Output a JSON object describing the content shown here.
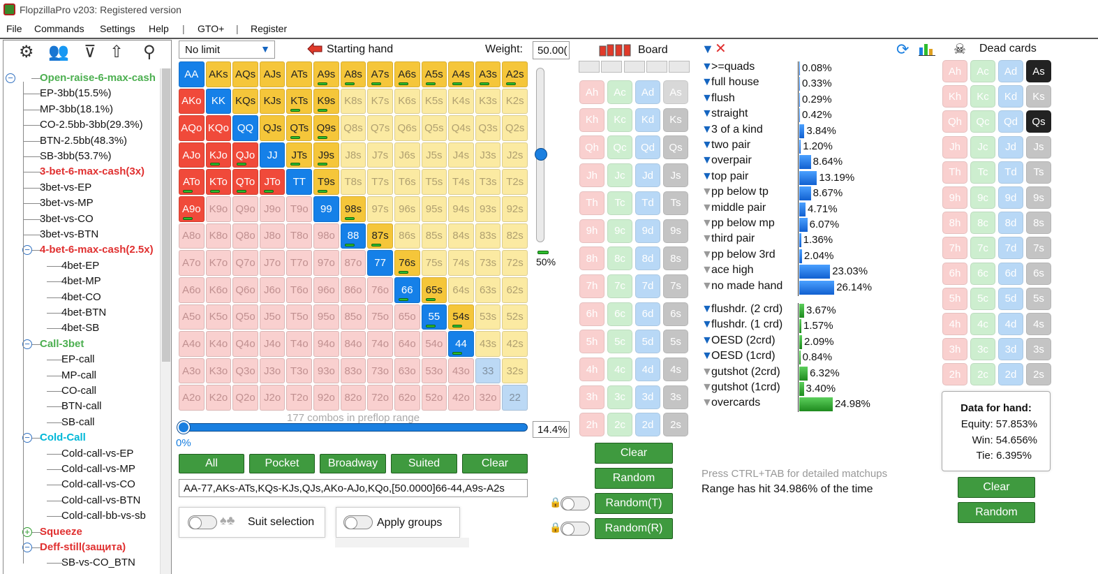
{
  "window": {
    "title": "FlopzillaPro v203: Registered version"
  },
  "menu": [
    "File",
    "Commands",
    "Settings",
    "Help",
    "|",
    "GTO+",
    "|",
    "Register"
  ],
  "tree": {
    "tool_icons": [
      "gear-icon",
      "users-icon",
      "filter-add-icon",
      "export-icon",
      "search-icon"
    ],
    "nodes": [
      {
        "label": "Open-raise-6-max-cash",
        "style": "green",
        "level": 0,
        "toggle": "−"
      },
      {
        "label": "EP-3bb(15.5%)",
        "style": "normal",
        "level": 1
      },
      {
        "label": "MP-3bb(18.1%)",
        "style": "normal",
        "level": 1
      },
      {
        "label": "CO-2.5bb-3bb(29.3%)",
        "style": "normal",
        "level": 1
      },
      {
        "label": "BTN-2.5bb(48.3%)",
        "style": "normal",
        "level": 1
      },
      {
        "label": "SB-3bb(53.7%)",
        "style": "normal",
        "level": 1
      },
      {
        "label": "3-bet-6-max-cash(3x)",
        "style": "red",
        "level": 1
      },
      {
        "label": "3bet-vs-EP",
        "style": "normal",
        "level": 1
      },
      {
        "label": "3bet-vs-MP",
        "style": "normal",
        "level": 1
      },
      {
        "label": "3bet-vs-CO",
        "style": "normal",
        "level": 1
      },
      {
        "label": "3bet-vs-BTN",
        "style": "normal",
        "level": 1
      },
      {
        "label": "4-bet-6-max-cash(2.5x)",
        "style": "red",
        "level": 1,
        "toggle": "−"
      },
      {
        "label": "4bet-EP",
        "style": "normal",
        "level": 2
      },
      {
        "label": "4bet-MP",
        "style": "normal",
        "level": 2
      },
      {
        "label": "4bet-CO",
        "style": "normal",
        "level": 2
      },
      {
        "label": "4bet-BTN",
        "style": "normal",
        "level": 2
      },
      {
        "label": "4bet-SB",
        "style": "normal",
        "level": 2
      },
      {
        "label": "Call-3bet",
        "style": "green",
        "level": 1,
        "toggle": "−"
      },
      {
        "label": "EP-call",
        "style": "normal",
        "level": 2
      },
      {
        "label": "MP-call",
        "style": "normal",
        "level": 2
      },
      {
        "label": "CO-call",
        "style": "normal",
        "level": 2
      },
      {
        "label": "BTN-call",
        "style": "normal",
        "level": 2
      },
      {
        "label": "SB-call",
        "style": "normal",
        "level": 2
      },
      {
        "label": "Cold-Call",
        "style": "cyan",
        "level": 1,
        "toggle": "−"
      },
      {
        "label": "Cold-call-vs-EP",
        "style": "normal",
        "level": 2
      },
      {
        "label": "Cold-call-vs-MP",
        "style": "normal",
        "level": 2
      },
      {
        "label": "Cold-call-vs-CO",
        "style": "normal",
        "level": 2
      },
      {
        "label": "Cold-call-vs-BTN",
        "style": "normal",
        "level": 2
      },
      {
        "label": "Cold-call-bb-vs-sb",
        "style": "normal",
        "level": 2
      },
      {
        "label": "Squeeze",
        "style": "red",
        "level": 1,
        "toggle": "+"
      },
      {
        "label": "Deff-still(защита)",
        "style": "red",
        "level": 1,
        "toggle": "−"
      },
      {
        "label": "SB-vs-CO_BTN",
        "style": "normal",
        "level": 2
      }
    ]
  },
  "range_panel": {
    "limit_select": "No limit",
    "starting_hand_label": "Starting hand",
    "weight_label": "Weight:",
    "weight_value": "50.00(",
    "vertical_slider_label": "50%",
    "combos_text": "177 combos in preflop range",
    "range_pct": "14.4%",
    "slider_min_label": "0%",
    "buttons": [
      "All",
      "Pocket",
      "Broadway",
      "Suited",
      "Clear"
    ],
    "range_text": "AA-77,AKs-ATs,KQs-KJs,QJs,AKo-AJo,KQo,[50.0000]66-44,A9s-A2s",
    "suit_selection_label": "Suit selection",
    "apply_groups_label": "Apply groups"
  },
  "hand_grid": {
    "ranks": [
      "A",
      "K",
      "Q",
      "J",
      "T",
      "9",
      "8",
      "7",
      "6",
      "5",
      "4",
      "3",
      "2"
    ],
    "cells": [
      [
        "AA:b",
        "AKs:y",
        "AQs:y",
        "AJs:y",
        "ATs:y",
        "A9s:yh",
        "A8s:yh",
        "A7s:yh",
        "A6s:yh",
        "A5s:yh",
        "A4s:yh",
        "A3s:yh",
        "A2s:yh"
      ],
      [
        "AKo:r",
        "KK:b",
        "KQs:y",
        "KJs:y",
        "KTs:yh",
        "K9s:yh",
        "K8s:l",
        "K7s:l",
        "K6s:l",
        "K5s:l",
        "K4s:l",
        "K3s:l",
        "K2s:l"
      ],
      [
        "AQo:r",
        "KQo:r",
        "QQ:b",
        "QJs:y",
        "QTs:yh",
        "Q9s:yh",
        "Q8s:l",
        "Q7s:l",
        "Q6s:l",
        "Q5s:l",
        "Q4s:l",
        "Q3s:l",
        "Q2s:l"
      ],
      [
        "AJo:r",
        "KJo:rh",
        "QJo:rh",
        "JJ:b",
        "JTs:yh",
        "J9s:yh",
        "J8s:l",
        "J7s:l",
        "J6s:l",
        "J5s:l",
        "J4s:l",
        "J3s:l",
        "J2s:l"
      ],
      [
        "ATo:rh",
        "KTo:rh",
        "QTo:rh",
        "JTo:rh",
        "TT:b",
        "T9s:yh",
        "T8s:l",
        "T7s:l",
        "T6s:l",
        "T5s:l",
        "T4s:l",
        "T3s:l",
        "T2s:l"
      ],
      [
        "A9o:rh",
        "K9o:p",
        "Q9o:p",
        "J9o:p",
        "T9o:p",
        "99:b",
        "98s:yh",
        "97s:l",
        "96s:l",
        "95s:l",
        "94s:l",
        "93s:l",
        "92s:l"
      ],
      [
        "A8o:p",
        "K8o:p",
        "Q8o:p",
        "J8o:p",
        "T8o:p",
        "98o:p",
        "88:bh",
        "87s:yh",
        "86s:l",
        "85s:l",
        "84s:l",
        "83s:l",
        "82s:l"
      ],
      [
        "A7o:p",
        "K7o:p",
        "Q7o:p",
        "J7o:p",
        "T7o:p",
        "97o:p",
        "87o:p",
        "77:b",
        "76s:yh",
        "75s:l",
        "74s:l",
        "73s:l",
        "72s:l"
      ],
      [
        "A6o:p",
        "K6o:p",
        "Q6o:p",
        "J6o:p",
        "T6o:p",
        "96o:p",
        "86o:p",
        "76o:p",
        "66:bh",
        "65s:yh",
        "64s:l",
        "63s:l",
        "62s:l"
      ],
      [
        "A5o:p",
        "K5o:p",
        "Q5o:p",
        "J5o:p",
        "T5o:p",
        "95o:p",
        "85o:p",
        "75o:p",
        "65o:p",
        "55:bh",
        "54s:yh",
        "53s:l",
        "52s:l"
      ],
      [
        "A4o:p",
        "K4o:p",
        "Q4o:p",
        "J4o:p",
        "T4o:p",
        "94o:p",
        "84o:p",
        "74o:p",
        "64o:p",
        "54o:p",
        "44:bh",
        "43s:l",
        "42s:l"
      ],
      [
        "A3o:p",
        "K3o:p",
        "Q3o:p",
        "J3o:p",
        "T3o:p",
        "93o:p",
        "83o:p",
        "73o:p",
        "63o:p",
        "53o:p",
        "43o:p",
        "33:c",
        "32s:l"
      ],
      [
        "A2o:p",
        "K2o:p",
        "Q2o:p",
        "J2o:p",
        "T2o:p",
        "92o:p",
        "82o:p",
        "72o:p",
        "62o:p",
        "52o:p",
        "42o:p",
        "32o:p",
        "22:c"
      ]
    ]
  },
  "board": {
    "label": "Board",
    "ranks": [
      "A",
      "K",
      "Q",
      "J",
      "T",
      "9",
      "8",
      "7",
      "6",
      "5",
      "4",
      "3",
      "2"
    ],
    "suits": [
      "h",
      "c",
      "d",
      "s"
    ],
    "buttons": [
      "Clear",
      "Random",
      "Random(T)",
      "Random(R)"
    ]
  },
  "stats": {
    "made_hands": [
      {
        "label": ">=quads",
        "value": "0.08%",
        "pct": 0.08,
        "filter": "blue"
      },
      {
        "label": "full house",
        "value": "0.33%",
        "pct": 0.33,
        "filter": "blue"
      },
      {
        "label": "flush",
        "value": "0.29%",
        "pct": 0.29,
        "filter": "blue"
      },
      {
        "label": "straight",
        "value": "0.42%",
        "pct": 0.42,
        "filter": "blue"
      },
      {
        "label": "3 of a kind",
        "value": "3.84%",
        "pct": 3.84,
        "filter": "blue"
      },
      {
        "label": "two pair",
        "value": "1.20%",
        "pct": 1.2,
        "filter": "blue"
      },
      {
        "label": "overpair",
        "value": "8.64%",
        "pct": 8.64,
        "filter": "blue"
      },
      {
        "label": "top pair",
        "value": "13.19%",
        "pct": 13.19,
        "filter": "blue"
      },
      {
        "label": "pp below tp",
        "value": "8.67%",
        "pct": 8.67,
        "filter": "grey"
      },
      {
        "label": "middle pair",
        "value": "4.71%",
        "pct": 4.71,
        "filter": "grey"
      },
      {
        "label": "pp below mp",
        "value": "6.07%",
        "pct": 6.07,
        "filter": "grey"
      },
      {
        "label": "third pair",
        "value": "1.36%",
        "pct": 1.36,
        "filter": "grey"
      },
      {
        "label": "pp below 3rd",
        "value": "2.04%",
        "pct": 2.04,
        "filter": "grey"
      },
      {
        "label": "ace high",
        "value": "23.03%",
        "pct": 23.03,
        "filter": "grey"
      },
      {
        "label": "no made hand",
        "value": "26.14%",
        "pct": 26.14,
        "filter": "grey"
      }
    ],
    "draws": [
      {
        "label": "flushdr. (2 crd)",
        "value": "3.67%",
        "pct": 3.67,
        "filter": "blue"
      },
      {
        "label": "flushdr. (1 crd)",
        "value": "1.57%",
        "pct": 1.57,
        "filter": "blue"
      },
      {
        "label": "OESD (2crd)",
        "value": "2.09%",
        "pct": 2.09,
        "filter": "blue"
      },
      {
        "label": "OESD (1crd)",
        "value": "0.84%",
        "pct": 0.84,
        "filter": "blue"
      },
      {
        "label": "gutshot (2crd)",
        "value": "6.32%",
        "pct": 6.32,
        "filter": "grey"
      },
      {
        "label": "gutshot (1crd)",
        "value": "3.40%",
        "pct": 3.4,
        "filter": "grey"
      },
      {
        "label": "overcards",
        "value": "24.98%",
        "pct": 24.98,
        "filter": "grey"
      }
    ],
    "hint": "Press CTRL+TAB for detailed matchups",
    "hit_text": "Range has hit 34.986% of the time"
  },
  "dead_cards": {
    "label": "Dead cards",
    "selected": [
      "As",
      "Qs"
    ],
    "dark": [
      "Ks",
      "Js",
      "Ts",
      "9s",
      "8s",
      "7s",
      "6s",
      "5s",
      "4s",
      "3s",
      "2s"
    ],
    "data_title": "Data for hand:",
    "equity": "Equity: 57.853%",
    "win": "Win: 54.656%",
    "tie": "Tie: 6.395%",
    "buttons": [
      "Clear",
      "Random"
    ]
  },
  "colors": {
    "accent": "#1580e8",
    "green_btn": "#3f9a3f",
    "red_cell": "#f04a3a",
    "yellow_cell": "#f5c63a"
  }
}
